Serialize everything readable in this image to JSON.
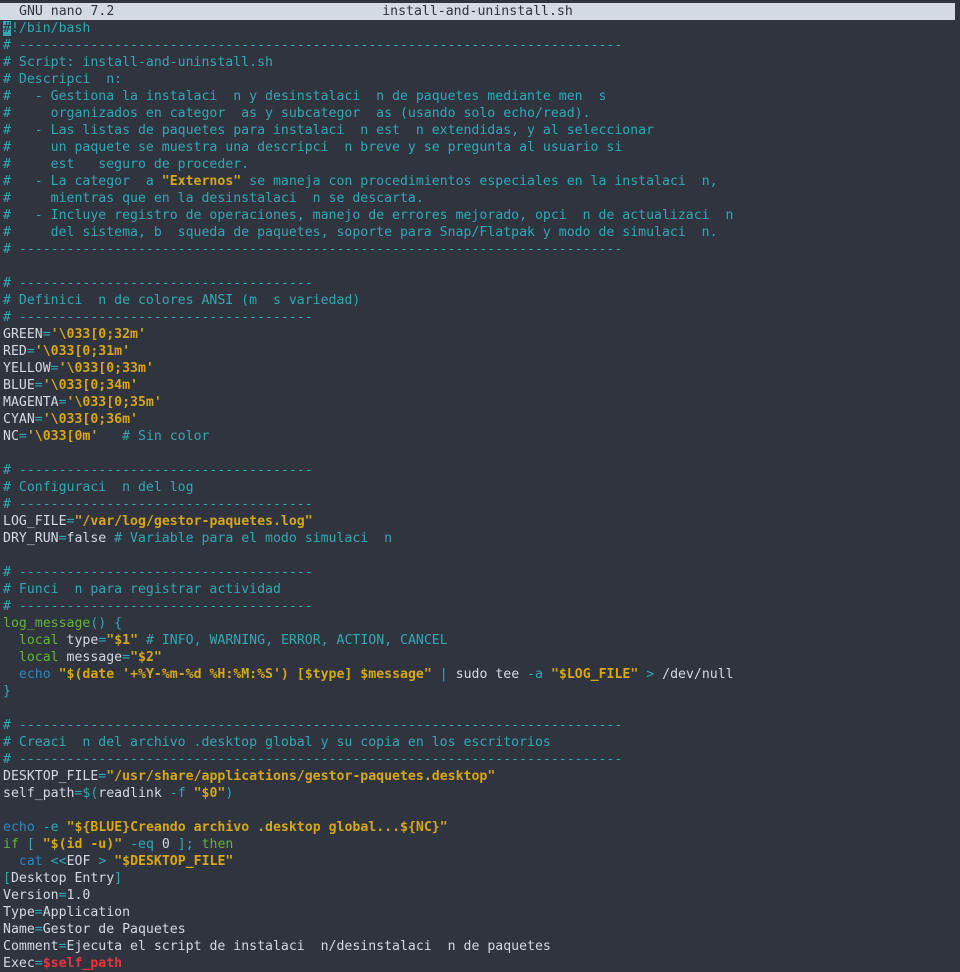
{
  "titlebar": {
    "app": "GNU nano 7.2",
    "filename": "install-and-uninstall.sh"
  },
  "editor": {
    "lines": [
      [
        [
          "cursor",
          "#"
        ],
        [
          "cm",
          "!/bin/bash"
        ]
      ],
      [
        [
          "cm",
          "# ----------------------------------------------------------------------------"
        ]
      ],
      [
        [
          "cm",
          "# Script: install-and-uninstall.sh"
        ]
      ],
      [
        [
          "cm",
          "# Descripci  n:"
        ]
      ],
      [
        [
          "cm",
          "#   - Gestiona la instalaci  n y desinstalaci  n de paquetes mediante men  s"
        ]
      ],
      [
        [
          "cm",
          "#     organizados en categor  as y subcategor  as (usando solo echo/read)."
        ]
      ],
      [
        [
          "cm",
          "#   - Las listas de paquetes para instalaci  n est  n extendidas, y al seleccionar"
        ]
      ],
      [
        [
          "cm",
          "#     un paquete se muestra una descripci  n breve y se pregunta al usuario si"
        ]
      ],
      [
        [
          "cm",
          "#     est   seguro de proceder."
        ]
      ],
      [
        [
          "cm",
          "#   - La categor  a "
        ],
        [
          "st",
          "\"Externos\""
        ],
        [
          "cm",
          " se maneja con procedimientos especiales en la instalaci  n,"
        ]
      ],
      [
        [
          "cm",
          "#     mientras que en la desinstalaci  n se descarta."
        ]
      ],
      [
        [
          "cm",
          "#   - Incluye registro de operaciones, manejo de errores mejorado, opci  n de actualizaci  n"
        ]
      ],
      [
        [
          "cm",
          "#     del sistema, b  squeda de paquetes, soporte para Snap/Flatpak y modo de simulaci  n."
        ]
      ],
      [
        [
          "cm",
          "# ----------------------------------------------------------------------------"
        ]
      ],
      [],
      [
        [
          "cm",
          "# -------------------------------------"
        ]
      ],
      [
        [
          "cm",
          "# Definici  n de colores ANSI (m  s variedad)"
        ]
      ],
      [
        [
          "cm",
          "# -------------------------------------"
        ]
      ],
      [
        [
          "",
          "GREEN"
        ],
        [
          "cy",
          "="
        ],
        [
          "st",
          "'\\033[0;32m'"
        ]
      ],
      [
        [
          "",
          "RED"
        ],
        [
          "cy",
          "="
        ],
        [
          "st",
          "'\\033[0;31m'"
        ]
      ],
      [
        [
          "",
          "YELLOW"
        ],
        [
          "cy",
          "="
        ],
        [
          "st",
          "'\\033[0;33m'"
        ]
      ],
      [
        [
          "",
          "BLUE"
        ],
        [
          "cy",
          "="
        ],
        [
          "st",
          "'\\033[0;34m'"
        ]
      ],
      [
        [
          "",
          "MAGENTA"
        ],
        [
          "cy",
          "="
        ],
        [
          "st",
          "'\\033[0;35m'"
        ]
      ],
      [
        [
          "",
          "CYAN"
        ],
        [
          "cy",
          "="
        ],
        [
          "st",
          "'\\033[0;36m'"
        ]
      ],
      [
        [
          "",
          "NC"
        ],
        [
          "cy",
          "="
        ],
        [
          "st",
          "'\\033[0m'"
        ],
        [
          "",
          "   "
        ],
        [
          "cm",
          "# Sin color"
        ]
      ],
      [],
      [
        [
          "cm",
          "# -------------------------------------"
        ]
      ],
      [
        [
          "cm",
          "# Configuraci  n del log"
        ]
      ],
      [
        [
          "cm",
          "# -------------------------------------"
        ]
      ],
      [
        [
          "",
          "LOG_FILE"
        ],
        [
          "cy",
          "="
        ],
        [
          "st",
          "\"/var/log/gestor-paquetes.log\""
        ]
      ],
      [
        [
          "",
          "DRY_RUN"
        ],
        [
          "cy",
          "="
        ],
        [
          "",
          "false "
        ],
        [
          "cm",
          "# Variable para el modo simulaci  n"
        ]
      ],
      [],
      [
        [
          "cm",
          "# -------------------------------------"
        ]
      ],
      [
        [
          "cm",
          "# Funci  n para registrar actividad"
        ]
      ],
      [
        [
          "cm",
          "# -------------------------------------"
        ]
      ],
      [
        [
          "fn",
          "log_message"
        ],
        [
          "cy",
          "() {"
        ]
      ],
      [
        [
          "",
          "  "
        ],
        [
          "fn",
          "local"
        ],
        [
          "",
          ""
        ],
        [
          "",
          "type"
        ],
        [
          "cy",
          "="
        ],
        [
          "st",
          "\"$1\""
        ],
        [
          "",
          ""
        ],
        [
          "cm",
          " # INFO, WARNING, ERROR, ACTION, CANCEL"
        ]
      ],
      [
        [
          "",
          "  "
        ],
        [
          "fn",
          "local"
        ],
        [
          "",
          "message"
        ],
        [
          "cy",
          "="
        ],
        [
          "st",
          "\"$2\""
        ]
      ],
      [
        [
          "",
          "  "
        ],
        [
          "kw",
          "echo"
        ],
        [
          "",
          " "
        ],
        [
          "st",
          "\"$(date '+%Y-%m-%d %H:%M:%S') [$type] $message\""
        ],
        [
          "",
          " "
        ],
        [
          "cy",
          "|"
        ],
        [
          "",
          " sudo tee "
        ],
        [
          "cy",
          "-a"
        ],
        [
          "",
          " "
        ],
        [
          "st",
          "\"$LOG_FILE\""
        ],
        [
          "",
          " "
        ],
        [
          "cy",
          ">"
        ],
        [
          "",
          " /dev/null"
        ]
      ],
      [
        [
          "cy",
          "}"
        ]
      ],
      [],
      [
        [
          "cm",
          "# ----------------------------------------------------------------------------"
        ]
      ],
      [
        [
          "cm",
          "# Creaci  n del archivo .desktop global y su copia en los escritorios"
        ]
      ],
      [
        [
          "cm",
          "# ----------------------------------------------------------------------------"
        ]
      ],
      [
        [
          "",
          "DESKTOP_FILE"
        ],
        [
          "cy",
          "="
        ],
        [
          "st",
          "\"/usr/share/applications/gestor-paquetes.desktop\""
        ]
      ],
      [
        [
          "",
          "self_path"
        ],
        [
          "cy",
          "=$("
        ],
        [
          "",
          "readlink "
        ],
        [
          "cy",
          "-f"
        ],
        [
          "",
          " "
        ],
        [
          "st",
          "\"$0\""
        ],
        [
          "cy",
          ")"
        ]
      ],
      [],
      [
        [
          "kw",
          "echo"
        ],
        [
          "",
          " "
        ],
        [
          "cy",
          "-e"
        ],
        [
          "",
          " "
        ],
        [
          "st",
          "\"${BLUE}Creando archivo .desktop global...${NC}\""
        ]
      ],
      [
        [
          "fn",
          "if"
        ],
        [
          "",
          " "
        ],
        [
          "cy",
          "[ "
        ],
        [
          "st",
          "\"$(id -u)\""
        ],
        [
          "",
          " "
        ],
        [
          "cy",
          "-eq"
        ],
        [
          "",
          " 0 "
        ],
        [
          "cy",
          "]; "
        ],
        [
          "fn",
          "then"
        ]
      ],
      [
        [
          "",
          "  "
        ],
        [
          "kw",
          "cat"
        ],
        [
          "",
          " "
        ],
        [
          "cy",
          "<<"
        ],
        [
          "",
          "EOF "
        ],
        [
          "cy",
          ">"
        ],
        [
          "",
          " "
        ],
        [
          "st",
          "\"$DESKTOP_FILE\""
        ]
      ],
      [
        [
          "cy",
          "["
        ],
        [
          "",
          "Desktop Entry"
        ],
        [
          "cy",
          "]"
        ]
      ],
      [
        [
          "",
          "Version"
        ],
        [
          "cy",
          "="
        ],
        [
          "",
          "1.0"
        ]
      ],
      [
        [
          "",
          "Type"
        ],
        [
          "cy",
          "="
        ],
        [
          "",
          "Application"
        ]
      ],
      [
        [
          "",
          "Name"
        ],
        [
          "cy",
          "="
        ],
        [
          "",
          "Gestor de Paquetes"
        ]
      ],
      [
        [
          "",
          "Comment"
        ],
        [
          "cy",
          "="
        ],
        [
          "",
          "Ejecuta el script de instalaci  n/desinstalaci  n de paquetes"
        ]
      ],
      [
        [
          "",
          "Exec"
        ],
        [
          "cy",
          "="
        ],
        [
          "rdb",
          "$self_path"
        ]
      ]
    ]
  }
}
